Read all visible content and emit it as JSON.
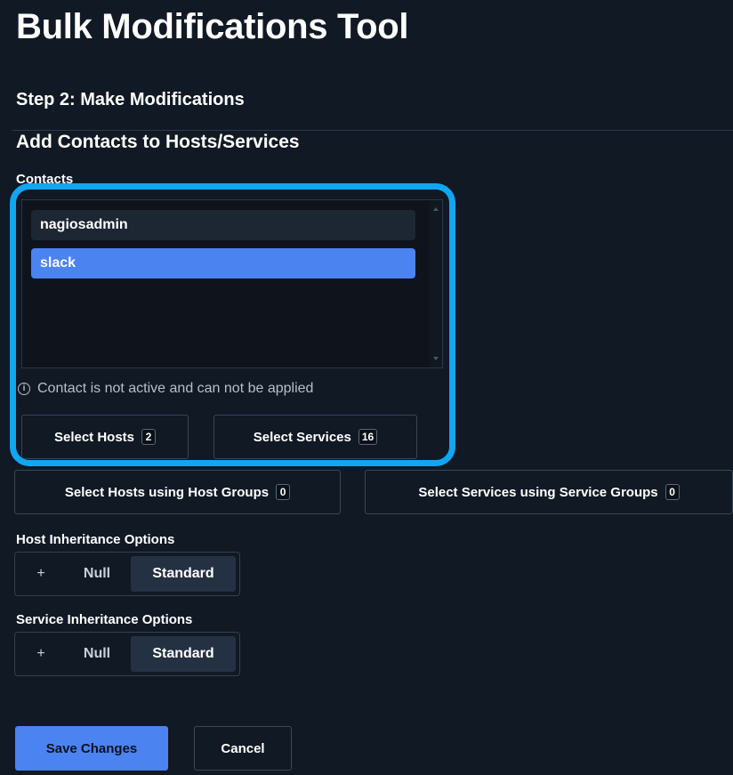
{
  "page": {
    "title": "Bulk Modifications Tool",
    "step_heading": "Step 2: Make Modifications",
    "section_heading": "Add Contacts to Hosts/Services",
    "contacts_label": "Contacts"
  },
  "contacts": {
    "options": [
      {
        "label": "nagiosadmin",
        "selected": false
      },
      {
        "label": "slack",
        "selected": true
      }
    ],
    "info_text": "Contact is not active and can not be applied"
  },
  "select_buttons": {
    "hosts": {
      "label": "Select Hosts",
      "count": "2"
    },
    "services": {
      "label": "Select Services",
      "count": "16"
    },
    "host_groups": {
      "label": "Select Hosts using Host Groups",
      "count": "0"
    },
    "service_groups": {
      "label": "Select Services using Service Groups",
      "count": "0"
    }
  },
  "host_inheritance": {
    "label": "Host Inheritance Options",
    "options": [
      "+",
      "Null",
      "Standard"
    ],
    "selected": "Standard"
  },
  "service_inheritance": {
    "label": "Service Inheritance Options",
    "options": [
      "+",
      "Null",
      "Standard"
    ],
    "selected": "Standard"
  },
  "actions": {
    "save_label": "Save Changes",
    "cancel_label": "Cancel"
  },
  "colors": {
    "background": "#111924",
    "accent": "#4b83f1",
    "highlight": "#11a6f1"
  },
  "icons": {
    "info": "info-circle-icon"
  }
}
